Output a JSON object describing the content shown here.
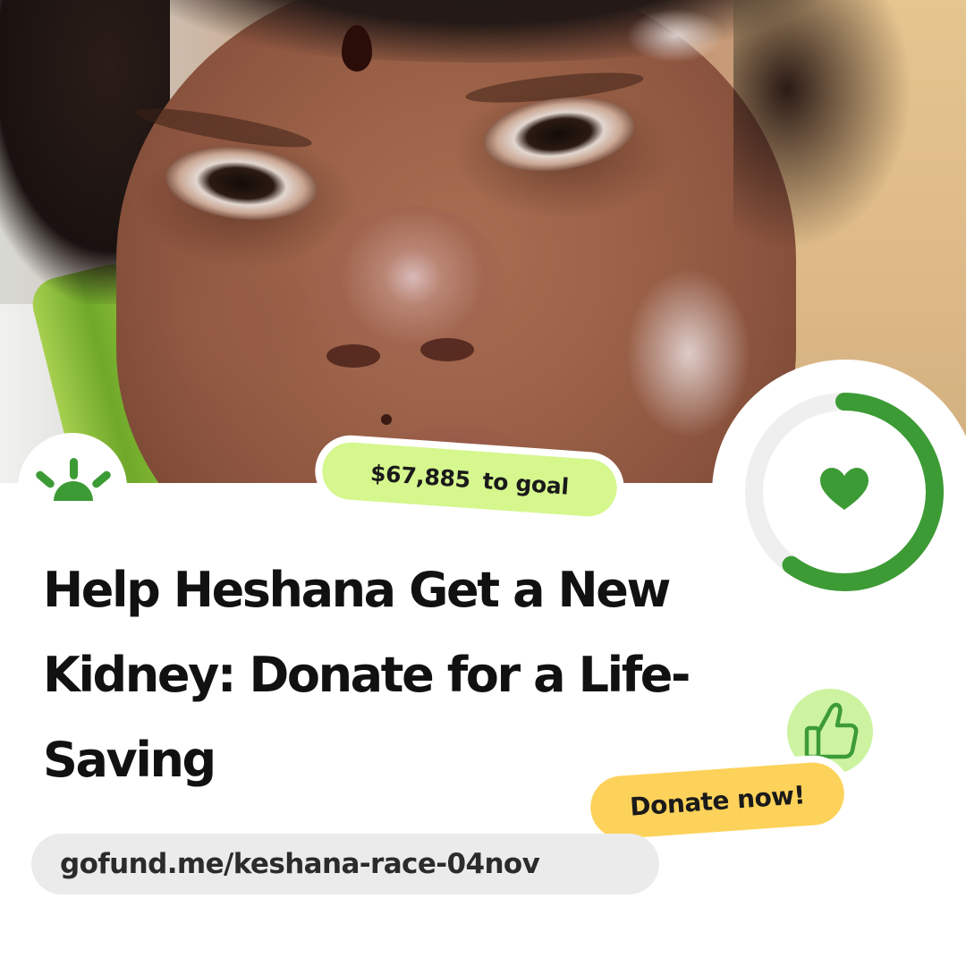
{
  "campaign": {
    "title": "Help Heshana Get a New Kidney: Donate for a Life-Saving",
    "goal_amount": "$67,885",
    "goal_suffix": "to goal",
    "progress_fraction": 0.6,
    "cta_label": "Donate now!",
    "url": "gofund.me/keshana-race-04nov"
  },
  "icons": {
    "brand": "gofundme-sun-logo-icon",
    "progress": "heart-icon",
    "reaction": "thumbs-up-icon"
  },
  "colors": {
    "brand_green": "#3d9b35",
    "goal_pill": "#d5f78d",
    "cta_pill": "#fdd25a",
    "thumb_bg": "#cdf3a1",
    "url_pill": "#ebebeb",
    "ring_track": "#efefef"
  }
}
